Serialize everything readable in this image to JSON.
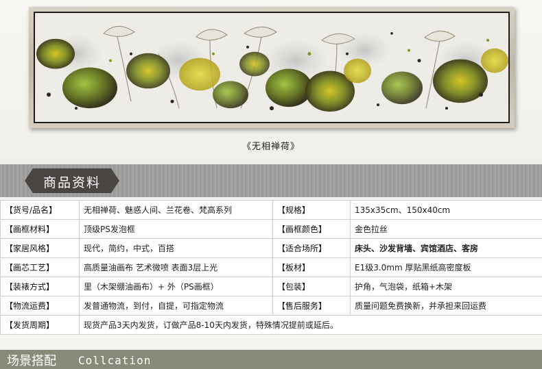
{
  "painting": {
    "title": "《无相禅荷》"
  },
  "section": {
    "title": "商品资料"
  },
  "specs": {
    "rows": [
      [
        "【货号/品名】",
        "无相禅荷、魅惑人间、兰花卷、梵高系列",
        "【规格】",
        "135x35cm、150x40cm"
      ],
      [
        "【画框材料】",
        "顶级PS发泡框",
        "【画框颜色】",
        "金色拉丝"
      ],
      [
        "【家居风格】",
        "现代，简约，中式，百搭",
        "【适合场所】",
        "床头、沙发背墙、宾馆酒店、客房"
      ],
      [
        "【画芯工艺】",
        "高质量油画布 艺术微喷 表面3层上光",
        "【板材】",
        "E1级3.0mm 厚贴黑纸高密度板"
      ],
      [
        "【装裱方式】",
        "里（木架绷油画布）+ 外（PS画框）",
        "【包装】",
        "护角，气泡袋，纸箱+木架"
      ],
      [
        "【物流运费】",
        "发普通物流，到付，自提，可指定物流",
        "【售后服务】",
        "质量问题免费换新，并承担来回运费"
      ]
    ],
    "last_row": [
      "【发货周期】",
      "现货产品3天内发货，订做产品8-10天内发货，特殊情况提前或延后。"
    ]
  },
  "footer": {
    "title_cn": "场景搭配",
    "title_en": "Collcation"
  },
  "colors": {
    "band": "#8a8a7a",
    "tag": "#4a4542",
    "lotus_green": "#7a8a1e",
    "lotus_yellow": "#c9b21a"
  }
}
